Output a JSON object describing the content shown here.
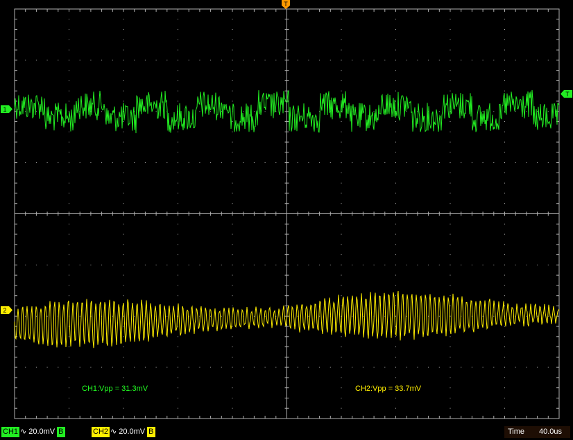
{
  "markers": {
    "trigger_pos": "T",
    "ch1_ground": "1",
    "ch2_ground": "2",
    "trigger_level": "T"
  },
  "measurements": {
    "ch1": "CH1:Vpp = 31.3mV",
    "ch2": "CH2:Vpp = 33.7mV"
  },
  "status": {
    "ch1": {
      "label": "CH1",
      "coupling": "∿",
      "scale": "20.0mV",
      "bw": "B"
    },
    "ch2": {
      "label": "CH2",
      "coupling": "∿",
      "scale": "20.0mV",
      "bw": "B"
    },
    "time_label": "Time",
    "time_value": "40.0us"
  },
  "colors": {
    "ch1": "#22ee22",
    "ch2": "#ffee00",
    "trigger": "#ff9900",
    "grid": "#b0b0b0"
  }
}
